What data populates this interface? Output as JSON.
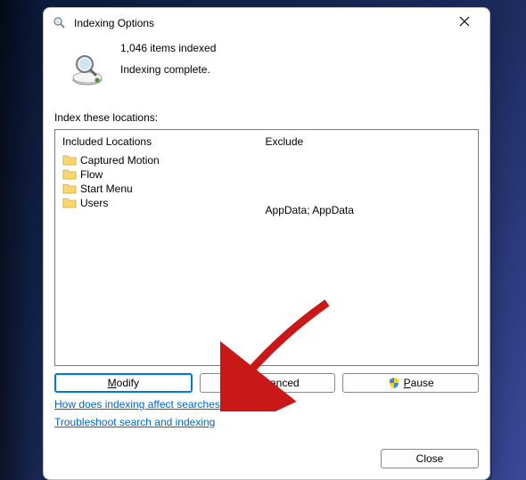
{
  "titlebar": {
    "title": "Indexing Options"
  },
  "status": {
    "count_line": "1,046 items indexed",
    "state_line": "Indexing complete."
  },
  "section_label": "Index these locations:",
  "columns": {
    "included_header": "Included Locations",
    "exclude_header": "Exclude"
  },
  "locations": [
    {
      "name": "Captured Motion",
      "exclude": ""
    },
    {
      "name": "Flow",
      "exclude": ""
    },
    {
      "name": "Start Menu",
      "exclude": ""
    },
    {
      "name": "Users",
      "exclude": "AppData; AppData"
    }
  ],
  "buttons": {
    "modify": "Modify",
    "advanced": "Advanced",
    "pause": "Pause",
    "close": "Close"
  },
  "links": {
    "how": "How does indexing affect searches?",
    "troubleshoot": "Troubleshoot search and indexing"
  }
}
